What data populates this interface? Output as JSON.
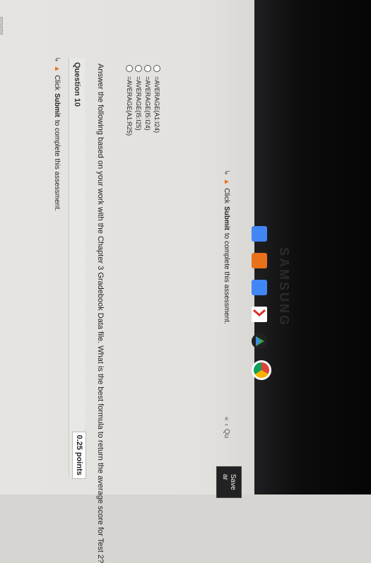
{
  "banner_top": {
    "action": "Click",
    "bold": "Submit",
    "rest": "to complete this assessment."
  },
  "question_label": "Question 10",
  "points": "0.25 points",
  "question_text": "Answer the following based on your work with the Chapter 3 Gradebook Data file. What is the best formula to return the average score for Test 2?",
  "options": [
    "=AVERAGE(A1:I24)",
    "=AVERAGE(I5:I24)",
    "=AVERAGE(I5:I25)",
    "=AVERAGE(A1:R25)"
  ],
  "banner_bottom": {
    "action": "Click",
    "bold": "Submit",
    "rest": "to complete this assessment."
  },
  "question_nav": "Qu",
  "save_label": "Save ar",
  "colors": {
    "warning": "#e46d1b",
    "save_bg": "#222222"
  },
  "icons": [
    "warning-icon",
    "arrow-icon",
    "radio-icon",
    "chrome-icon",
    "play-store-icon",
    "gmail-icon",
    "files-icon",
    "docs-icon"
  ]
}
